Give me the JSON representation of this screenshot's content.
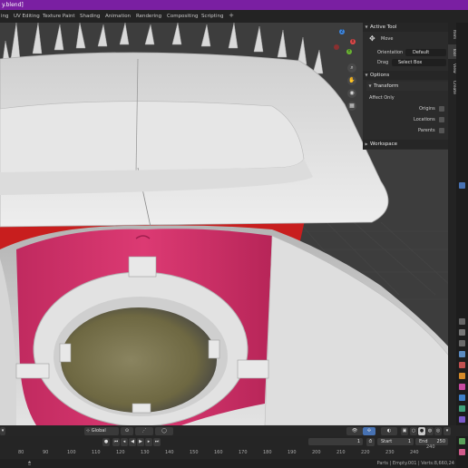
{
  "window": {
    "title": "y.blend]"
  },
  "workspace_tabs": [
    {
      "label": "ing"
    },
    {
      "label": "UV Editing"
    },
    {
      "label": "Texture Paint"
    },
    {
      "label": "Shading"
    },
    {
      "label": "Animation"
    },
    {
      "label": "Rendering"
    },
    {
      "label": "Compositing"
    },
    {
      "label": "Scripting"
    }
  ],
  "gizmo": {
    "x": "X",
    "y": "Y",
    "z": "Z"
  },
  "npanel": {
    "active_tool": {
      "header": "Active Tool",
      "tool": "Move",
      "orientation_label": "Orientation",
      "orientation_value": "Default",
      "drag_label": "Drag",
      "drag_value": "Select Box"
    },
    "options": {
      "header": "Options",
      "transform_header": "Transform",
      "affect_only": "Affect Only",
      "origins": "Origins",
      "locations": "Locations",
      "parents": "Parents"
    },
    "workspace": {
      "header": "Workspace"
    }
  },
  "side_tabs": {
    "item": "Item",
    "tool": "Tool",
    "view": "View",
    "create": "Create"
  },
  "viewport_header": {
    "orientation": "Global",
    "options": "Options"
  },
  "timeline": {
    "current_frame": "1",
    "start_label": "Start",
    "start_value": "1",
    "end_label": "End",
    "end_value": "250",
    "frame_numbers": [
      "80",
      "90",
      "100",
      "110",
      "120",
      "130",
      "140",
      "150",
      "160",
      "170",
      "180",
      "190",
      "200",
      "210",
      "220",
      "230",
      "240"
    ],
    "partial_number": "240"
  },
  "statusbar": {
    "text": "Parts | Empty.001 | Verts:8,660,24"
  },
  "colors": {
    "titlebar": "#7a1fa2",
    "accent": "#4772b3",
    "mesh": "#d8d8d8",
    "pink": "#d2346a",
    "red": "#c81e1e"
  }
}
